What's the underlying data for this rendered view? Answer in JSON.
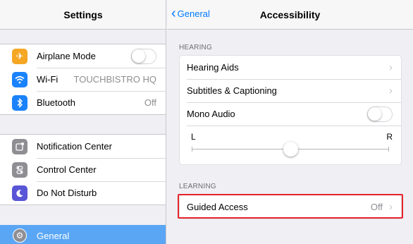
{
  "left": {
    "title": "Settings",
    "group1": [
      {
        "label": "Airplane Mode",
        "icon": "airplane-icon",
        "color": "#f5a623",
        "control": "toggle",
        "on": false
      },
      {
        "label": "Wi-Fi",
        "icon": "wifi-icon",
        "color": "#1a82fb",
        "value": "TOUCHBISTRO HQ"
      },
      {
        "label": "Bluetooth",
        "icon": "bluetooth-icon",
        "color": "#1a82fb",
        "value": "Off"
      }
    ],
    "group2": [
      {
        "label": "Notification Center",
        "icon": "notification-center-icon",
        "color": "#8e8e93"
      },
      {
        "label": "Control Center",
        "icon": "control-center-icon",
        "color": "#8e8e93"
      },
      {
        "label": "Do Not Disturb",
        "icon": "moon-icon",
        "color": "#5856d6"
      }
    ],
    "selected": {
      "label": "General",
      "icon": "gear-icon",
      "color": "#5aa6f5"
    }
  },
  "right": {
    "back_label": "General",
    "title": "Accessibility",
    "hearing": {
      "section_label": "HEARING",
      "hearing_aids": "Hearing Aids",
      "subtitles": "Subtitles & Captioning",
      "mono_audio": "Mono Audio",
      "mono_audio_on": false,
      "balance_left": "L",
      "balance_right": "R",
      "balance_value": 0.5
    },
    "learning": {
      "section_label": "LEARNING",
      "guided_access": "Guided Access",
      "guided_access_value": "Off"
    }
  },
  "colors": {
    "accent": "#007aff",
    "highlight": "#e5232b"
  }
}
